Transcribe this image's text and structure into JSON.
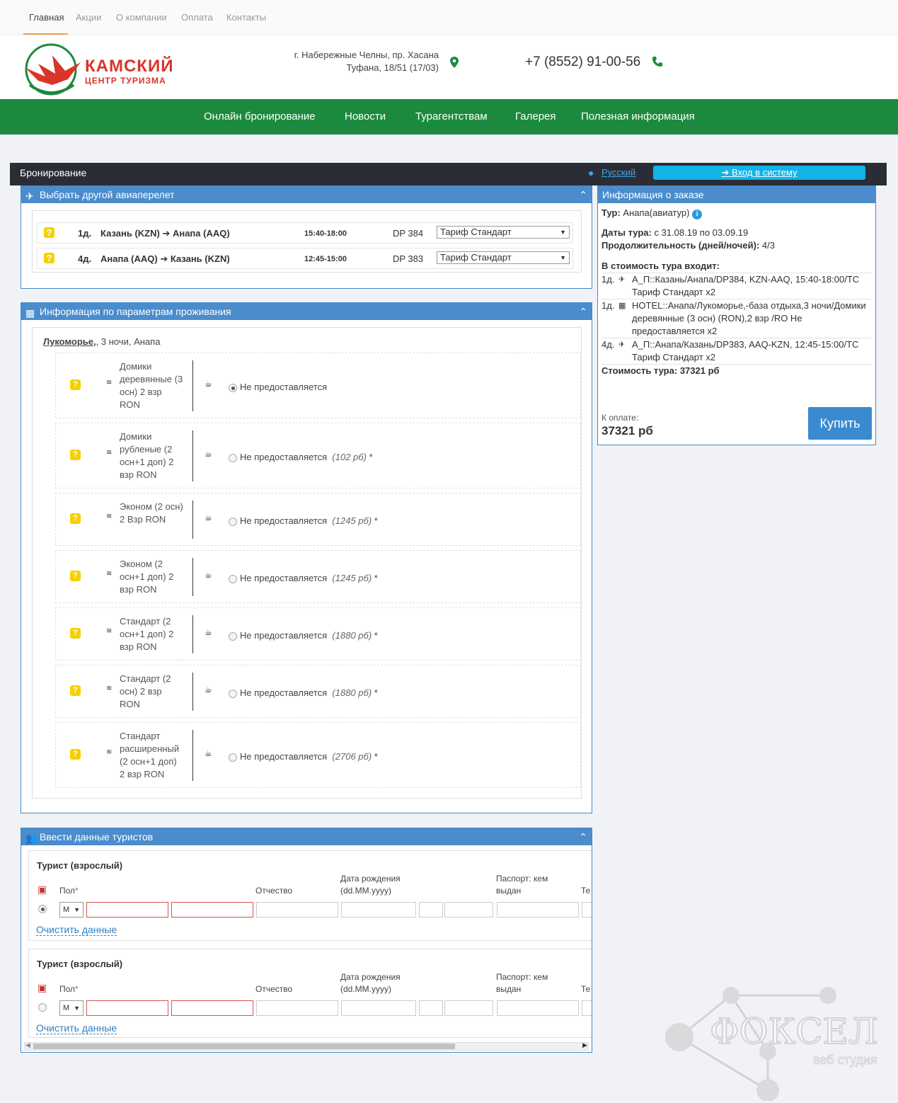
{
  "topnav": {
    "items": [
      "Главная",
      "Акции",
      "О компании",
      "Оплата",
      "Контакты"
    ]
  },
  "header": {
    "logo_line1": "КАМСКИЙ",
    "logo_line2": "ЦЕНТР ТУРИЗМА",
    "address_line1": "г. Набережные Челны, пр. Хасана",
    "address_line2": "Туфана, 18/51 (17/03)",
    "phone": "+7 (8552) 91-00-56"
  },
  "mainnav": {
    "items": [
      "Онлайн бронирование",
      "Новости",
      "Турагентствам",
      "Галерея",
      "Полезная информация"
    ]
  },
  "bar": {
    "title": "Бронирование",
    "lang": "Русский",
    "login": "Вход в систему"
  },
  "flights_panel": {
    "title": "Выбрать другой авиаперелет",
    "rows": [
      {
        "day": "1д.",
        "route": "Казань (KZN) ➔ Анапа (AAQ)",
        "time": "15:40-18:00",
        "flight": "DP 384",
        "tariff": "Тариф Стандарт"
      },
      {
        "day": "4д.",
        "route": "Анапа (AAQ) ➔ Казань (KZN)",
        "time": "12:45-15:00",
        "flight": "DP 383",
        "tariff": "Тариф Стандарт"
      }
    ]
  },
  "accom_panel": {
    "title": "Информация по параметрам проживания",
    "hotel_link": "Лукоморье,",
    "hotel_rest": ", 3 ночи, Анапа",
    "rooms": [
      {
        "name": "Домики деревянные (3 осн) 2 взр RON",
        "meal": "Не предоставляется",
        "price": ""
      },
      {
        "name": "Домики рубленые (2 осн+1 доп) 2 взр RON",
        "meal": "Не предоставляется",
        "price": "(102 рб)"
      },
      {
        "name": "Эконом (2 осн) 2 Взр RON",
        "meal": "Не предоставляется",
        "price": "(1245 рб)"
      },
      {
        "name": "Эконом (2 осн+1 доп) 2 взр RON",
        "meal": "Не предоставляется",
        "price": "(1245 рб)"
      },
      {
        "name": "Стандарт (2 осн+1 доп) 2 взр RON",
        "meal": "Не предоставляется",
        "price": "(1880 рб)"
      },
      {
        "name": "Стандарт (2 осн) 2 взр RON",
        "meal": "Не предоставляется",
        "price": "(1880 рб)"
      },
      {
        "name": "Стандарт расширенный (2 осн+1 доп) 2 взр RON",
        "meal": "Не предоставляется",
        "price": "(2706 рб)"
      }
    ],
    "star": "*"
  },
  "tourists_panel": {
    "title": "Ввести данные туристов",
    "tourists": [
      {
        "title": "Турист (взрослый)",
        "sex_label": "Пол",
        "req": "*",
        "patronymic_label": "Отчество",
        "dob_label": "Дата рождения (dd.MM.yyyy)",
        "passport_label": "Паспорт: кем выдан",
        "phone_label": "Те",
        "sex_value": "М",
        "clear": "Очистить данные"
      },
      {
        "title": "Турист (взрослый)",
        "sex_label": "Пол",
        "req": "*",
        "patronymic_label": "Отчество",
        "dob_label": "Дата рождения (dd.MM.yyyy)",
        "passport_label": "Паспорт: кем выдан",
        "phone_label": "Те",
        "sex_value": "М",
        "clear": "Очистить данные"
      }
    ]
  },
  "order": {
    "title": "Информация о заказе",
    "tour_label": "Тур:",
    "tour_value": "Анапа(авиатур)",
    "dates_label": "Даты тура:",
    "dates_value": "с 31.08.19 по 03.09.19",
    "duration_label": "Продолжительность (дней/ночей):",
    "duration_value": "4/3",
    "includes_label": "В стоимость тура входит:",
    "items": [
      {
        "day": "1д.",
        "text": "А_П::Казань/Анапа/DP384, KZN-AAQ, 15:40-18:00/ТС Тариф Стандарт x2"
      },
      {
        "day": "1д.",
        "text": "HOTEL::Анапа/Лукоморье,-база отдыха,3 ночи/Домики деревянные (3 осн) (RON),2 взр /RO Не предоставляется x2"
      },
      {
        "day": "4д.",
        "text": "А_П::Анапа/Казань/DP383, AAQ-KZN, 12:45-15:00/ТС Тариф Стандарт x2"
      }
    ],
    "cost_label": "Стоимость тура:",
    "cost_value": "37321 рб",
    "pay_label": "К оплате:",
    "pay_value": "37321 рб",
    "buy": "Купить"
  },
  "watermark": {
    "brand": "ФОКСЕЛ",
    "sub": "веб студия"
  },
  "colors": {
    "green": "#1b8a3e",
    "blue": "#4a8ccc",
    "dark": "#2b2d36",
    "cyan": "#14b3e6",
    "yellow": "#f4d100",
    "red": "#d9352a"
  }
}
